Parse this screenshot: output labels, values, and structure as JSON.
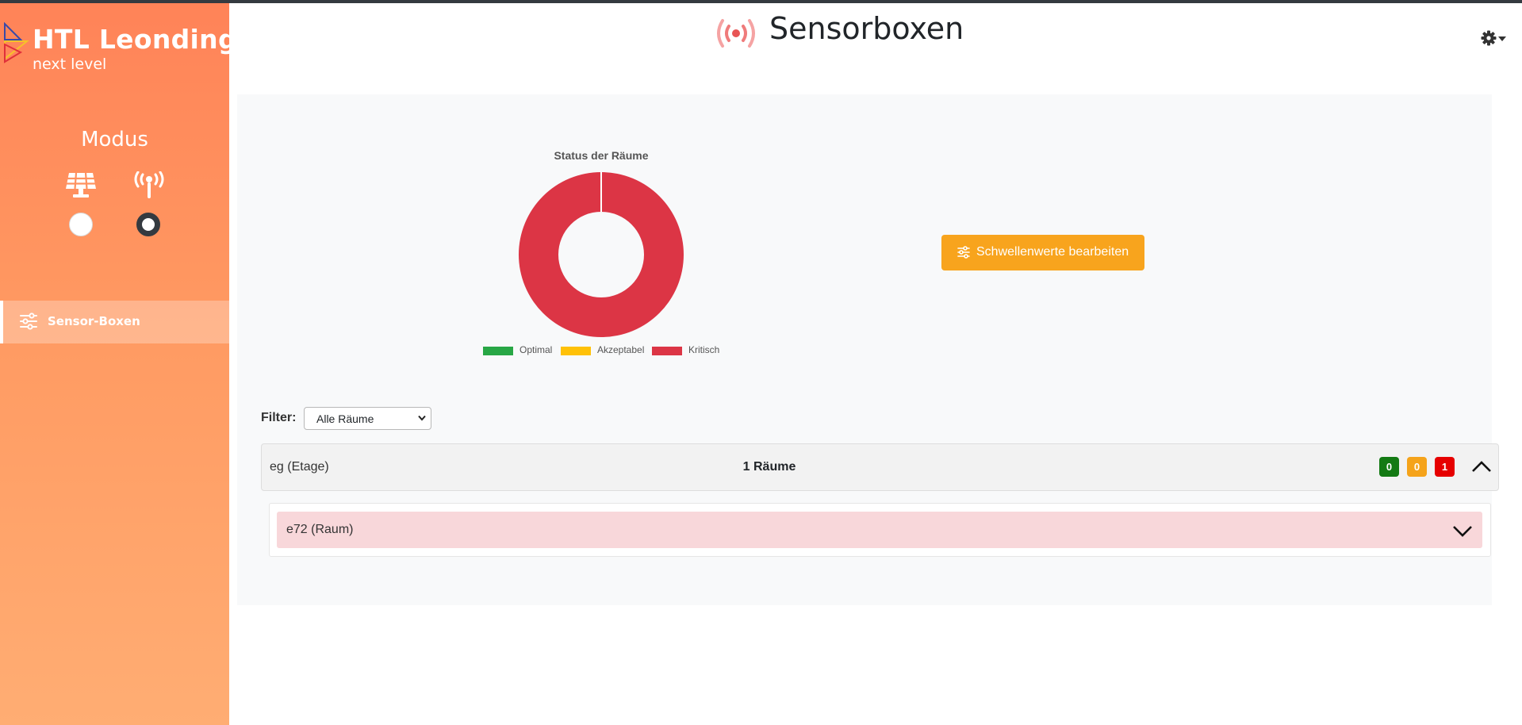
{
  "sidebar": {
    "logo": {
      "title": "HTL Leonding",
      "subtitle": "next level"
    },
    "mode": {
      "title": "Modus",
      "options": [
        {
          "icon": "solar-panel-icon",
          "selected": false
        },
        {
          "icon": "antenna-icon",
          "selected": true
        }
      ]
    },
    "nav": [
      {
        "label": "Sensor-Boxen",
        "icon": "sliders-icon",
        "active": true
      }
    ]
  },
  "header": {
    "title": "Sensorboxen",
    "icon": "broadcast-icon",
    "settings_icon": "gear-icon"
  },
  "chart": {
    "title": "Status der Räume",
    "legend": [
      "Optimal",
      "Akzeptabel",
      "Kritisch"
    ]
  },
  "chart_data": {
    "type": "pie",
    "title": "Status der Räume",
    "categories": [
      "Optimal",
      "Akzeptabel",
      "Kritisch"
    ],
    "values": [
      0,
      0,
      1
    ],
    "colors": [
      "#28a745",
      "#ffc107",
      "#dc3545"
    ],
    "donut": true,
    "legend": "bottom"
  },
  "actions": {
    "edit_thresholds_label": "Schwellenwerte bearbeiten"
  },
  "filter": {
    "label": "Filter:",
    "selected": "Alle Räume"
  },
  "floors": [
    {
      "name": "eg (Etage)",
      "room_count_label": "1 Räume",
      "badges": [
        {
          "value": "0",
          "color": "#137a13"
        },
        {
          "value": "0",
          "color": "#f5a31a"
        },
        {
          "value": "1",
          "color": "#e60000"
        }
      ],
      "expanded": true,
      "rooms": [
        {
          "name": "e72 (Raum)",
          "status_color": "#f8d7da",
          "expanded": false
        }
      ]
    }
  ]
}
